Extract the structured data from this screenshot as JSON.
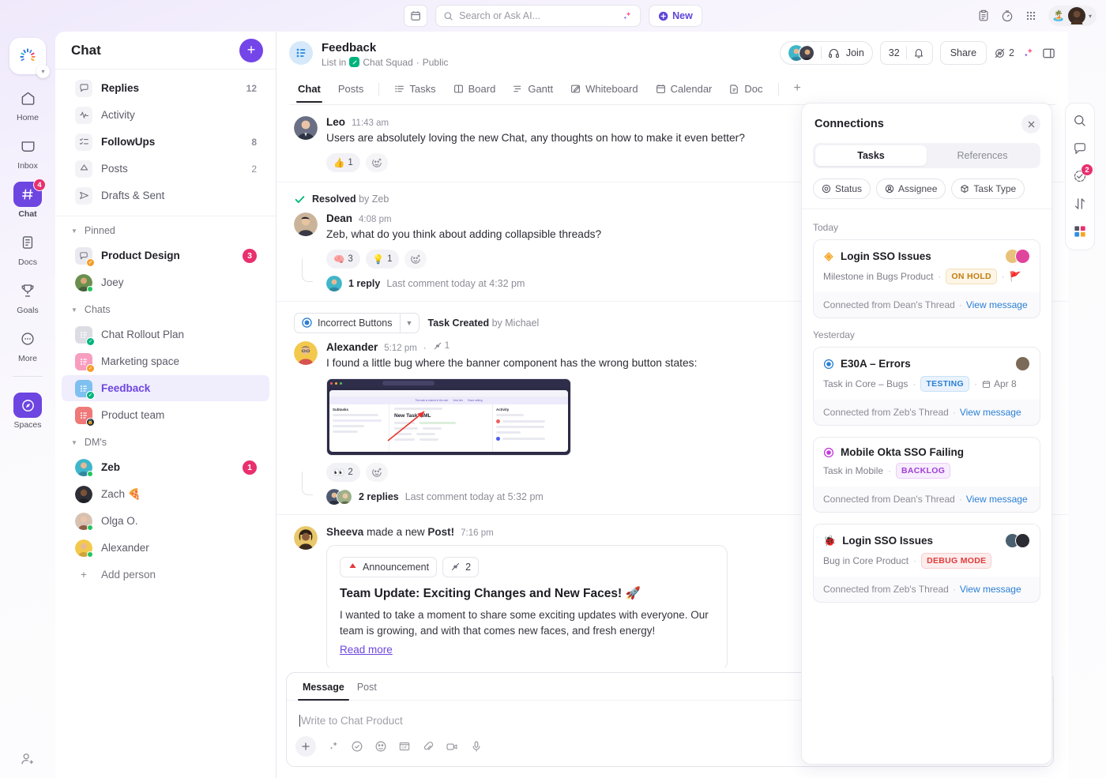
{
  "topbar": {
    "calendar_icon": "calendar-icon",
    "search_placeholder": "Search or Ask AI...",
    "search_value": "",
    "ai_icon": "ai-sparkle-icon",
    "new_label": "New",
    "right_icons": [
      "clipboard-icon",
      "timer-icon",
      "apps-grid-icon"
    ],
    "status_emoji": "🏝️"
  },
  "rail": {
    "items": [
      {
        "label": "Home",
        "icon": "home-icon",
        "badge": ""
      },
      {
        "label": "Inbox",
        "icon": "inbox-icon",
        "badge": ""
      },
      {
        "label": "Chat",
        "icon": "hash-icon",
        "badge": "4"
      },
      {
        "label": "Docs",
        "icon": "doc-icon",
        "badge": ""
      },
      {
        "label": "Goals",
        "icon": "trophy-icon",
        "badge": ""
      },
      {
        "label": "More",
        "icon": "more-icon",
        "badge": ""
      },
      {
        "label": "Spaces",
        "icon": "compass-icon",
        "badge": ""
      }
    ],
    "bottom_icon": "add-person-icon"
  },
  "sidebar": {
    "title": "Chat",
    "add_label": "+",
    "nav": [
      {
        "label": "Replies",
        "count": "12",
        "icon": "reply-bubble-icon",
        "bold": true
      },
      {
        "label": "Activity",
        "count": "",
        "icon": "activity-pulse-icon",
        "bold": false
      },
      {
        "label": "FollowUps",
        "count": "8",
        "icon": "checklist-icon",
        "bold": true
      },
      {
        "label": "Posts",
        "count": "2",
        "icon": "megaphone-icon",
        "bold": false
      },
      {
        "label": "Drafts & Sent",
        "count": "",
        "icon": "send-icon",
        "bold": false
      }
    ],
    "groups": [
      {
        "label": "Pinned",
        "items": [
          {
            "label": "Product Design",
            "badge": "3",
            "bold": true,
            "avatar": "chat-bubble-avatar",
            "color": "#e9e9ef",
            "mini": "#f59d2b"
          },
          {
            "label": "Joey",
            "badge": "",
            "bold": false,
            "avatar": "photo",
            "color": "#4f7f4a",
            "mini": "#22c55e"
          }
        ]
      },
      {
        "label": "Chats",
        "items": [
          {
            "label": "Chat Rollout Plan",
            "badge": "",
            "bold": false,
            "avatar": "list-avatar",
            "color": "#d8d8e0",
            "mini": "#00b37d"
          },
          {
            "label": "Marketing space",
            "badge": "",
            "bold": false,
            "avatar": "list-avatar",
            "color": "#f7a8c4",
            "mini": "#f59d2b"
          },
          {
            "label": "Feedback",
            "badge": "",
            "bold": false,
            "selected": true,
            "avatar": "list-avatar",
            "color": "#7ec0f0",
            "mini": "#00b37d"
          },
          {
            "label": "Product team",
            "badge": "",
            "bold": false,
            "avatar": "list-avatar",
            "color": "#ef7878",
            "mini": "#22222c"
          }
        ]
      },
      {
        "label": "DM's",
        "items": [
          {
            "label": "Zeb",
            "badge": "1",
            "bold": true,
            "avatar": "photo",
            "color": "#3fb6c9",
            "mini": "#22c55e"
          },
          {
            "label": "Zach 🍕",
            "badge": "",
            "bold": false,
            "avatar": "photo",
            "color": "#3b3b44",
            "mini": ""
          },
          {
            "label": "Olga O.",
            "badge": "",
            "bold": false,
            "avatar": "photo",
            "color": "#c59a86",
            "mini": "#22c55e"
          },
          {
            "label": "Alexander",
            "badge": "",
            "bold": false,
            "avatar": "photo",
            "color": "#f2c94c",
            "mini": "#22c55e"
          }
        ]
      }
    ],
    "add_person_label": "Add person"
  },
  "channel": {
    "name": "Feedback",
    "subtitle_prefix": "List in",
    "space": "Chat Squad",
    "visibility": "Public",
    "join_label": "Join",
    "member_count": "32",
    "bell_icon": "bell-icon",
    "share_label": "Share",
    "link_count": "2",
    "ai_icon": "ai-sparkle-icon",
    "panel_icon": "side-panel-icon",
    "tabs": [
      {
        "label": "Chat",
        "icon": "",
        "active": true
      },
      {
        "label": "Posts",
        "icon": "",
        "active": false
      },
      {
        "label": "Tasks",
        "icon": "list-icon",
        "active": false
      },
      {
        "label": "Board",
        "icon": "board-icon",
        "active": false
      },
      {
        "label": "Gantt",
        "icon": "gantt-icon",
        "active": false
      },
      {
        "label": "Whiteboard",
        "icon": "whiteboard-icon",
        "active": false
      },
      {
        "label": "Calendar",
        "icon": "calendar-icon",
        "active": false
      },
      {
        "label": "Doc",
        "icon": "doc-icon",
        "active": false
      },
      {
        "label": "+",
        "icon": "plus-icon",
        "active": false
      }
    ]
  },
  "messages": [
    {
      "author": "Leo",
      "time": "11:43 am",
      "text": "Users are absolutely loving the new Chat, any thoughts on how to make it even better?",
      "avatar_color": "#46506b",
      "reactions": [
        {
          "emoji": "👍",
          "count": "1"
        }
      ],
      "add_reaction_icon": "add-reaction-icon"
    },
    {
      "resolved_label": "Resolved",
      "resolved_by_prefix": "by",
      "resolved_by": "Zeb",
      "author": "Dean",
      "time": "4:08 pm",
      "text": "Zeb, what do you think about adding collapsible threads?",
      "avatar_color": "#3a3a46",
      "reactions": [
        {
          "emoji": "🧠",
          "count": "3"
        },
        {
          "emoji": "💡",
          "count": "1"
        }
      ],
      "add_reaction_icon": "add-reaction-icon",
      "thread_count": "1 reply",
      "thread_meta": "Last comment today at 4:32 pm"
    },
    {
      "task_chip": "Incorrect Buttons",
      "task_created_label": "Task Created",
      "task_created_by_prefix": "by",
      "task_created_by": "Michael",
      "author": "Alexander",
      "time": "5:12 pm",
      "link_count": "1",
      "text": "I found a little bug where the banner component has the wrong button states:",
      "avatar_color": "#f2c94c",
      "attachment": {
        "type": "screenshot",
        "title": "New Task TIML",
        "panel_left": "Subtasks",
        "panel_right": "Activity",
        "banner_text": "This task is shared in the web",
        "banner_btn1": "View link",
        "banner_btn2": "Share setting",
        "rows": [
          "Status",
          "Assignees",
          "Dates",
          "Priority"
        ]
      },
      "reactions": [
        {
          "emoji": "👀",
          "count": "2"
        }
      ],
      "thread_count": "2 replies",
      "thread_meta": "Last comment today at 5:32 pm"
    },
    {
      "author": "Sheeva",
      "action_prefix": "made a new",
      "action_word": "Post!",
      "time": "7:16 pm",
      "avatar_color": "#8a5a3c",
      "post": {
        "tag": "Announcement",
        "tag_emoji": "📣",
        "link_count": "2",
        "title": "Team Update: Exciting Changes and New Faces! 🚀",
        "body": "I wanted to take a moment to share some exciting updates with everyone. Our team is growing, and with that comes new faces, and fresh energy!",
        "read_more": "Read more"
      }
    }
  ],
  "composer": {
    "tabs": [
      {
        "label": "Message",
        "active": true
      },
      {
        "label": "Post",
        "active": false
      }
    ],
    "placeholder": "Write to Chat Product",
    "value": "",
    "tools": [
      "plus-icon",
      "ai-sparkle-icon",
      "task-check-icon",
      "emoji-icon",
      "gif-icon",
      "attach-icon",
      "video-icon",
      "mic-icon"
    ],
    "send_icon": "send-icon"
  },
  "connections": {
    "title": "Connections",
    "close_icon": "close-icon",
    "tabs": [
      {
        "label": "Tasks",
        "active": true
      },
      {
        "label": "References",
        "active": false
      }
    ],
    "filters": [
      {
        "label": "Status",
        "icon": "status-icon"
      },
      {
        "label": "Assignee",
        "icon": "assignee-icon"
      },
      {
        "label": "Task Type",
        "icon": "task-type-icon"
      }
    ],
    "sections": [
      {
        "day": "Today",
        "cards": [
          {
            "name": "Login SSO Issues",
            "type_icon": "milestone-icon",
            "type_color": "#f5a623",
            "meta": "Milestone in Bugs Product",
            "status": "ON HOLD",
            "status_class": "st-onhold",
            "flag": "🚩",
            "date": "",
            "avatars": [
              "#e8c27a",
              "#e0459e"
            ],
            "footer": "Connected from Dean's Thread",
            "link": "View message"
          }
        ]
      },
      {
        "day": "Yesterday",
        "cards": [
          {
            "name": "E30A – Errors",
            "type_icon": "task-circle-icon",
            "type_color": "#2a7fd4",
            "meta": "Task in Core – Bugs",
            "status": "TESTING",
            "status_class": "st-testing",
            "flag": "",
            "date": "Apr 8",
            "avatars": [
              "#7c6a58"
            ],
            "footer": "Connected from Zeb's Thread",
            "link": "View message"
          },
          {
            "name": "Mobile Okta SSO Failing",
            "type_icon": "task-circle-icon",
            "type_color": "#c23bd8",
            "meta": "Task in Mobile",
            "status": "BACKLOG",
            "status_class": "st-backlog",
            "flag": "",
            "date": "",
            "avatars": [],
            "footer": "Connected from Dean's Thread",
            "link": "View message"
          },
          {
            "name": "Login SSO Issues",
            "type_icon": "bug-icon",
            "type_color": "#e03a3a",
            "meta": "Bug in Core Product",
            "status": "DEBUG MODE",
            "status_class": "st-debug",
            "flag": "",
            "date": "",
            "avatars": [
              "#4a6070",
              "#2b2b33"
            ],
            "footer": "Connected from Zeb's Thread",
            "link": "View message"
          }
        ]
      }
    ]
  },
  "right_rail": {
    "items": [
      {
        "icon": "search-icon",
        "badge": ""
      },
      {
        "icon": "comment-icon",
        "badge": ""
      },
      {
        "icon": "task-check-icon",
        "badge": "2"
      },
      {
        "icon": "transfer-icon",
        "badge": ""
      },
      {
        "icon": "apps-icon",
        "badge": ""
      }
    ]
  }
}
